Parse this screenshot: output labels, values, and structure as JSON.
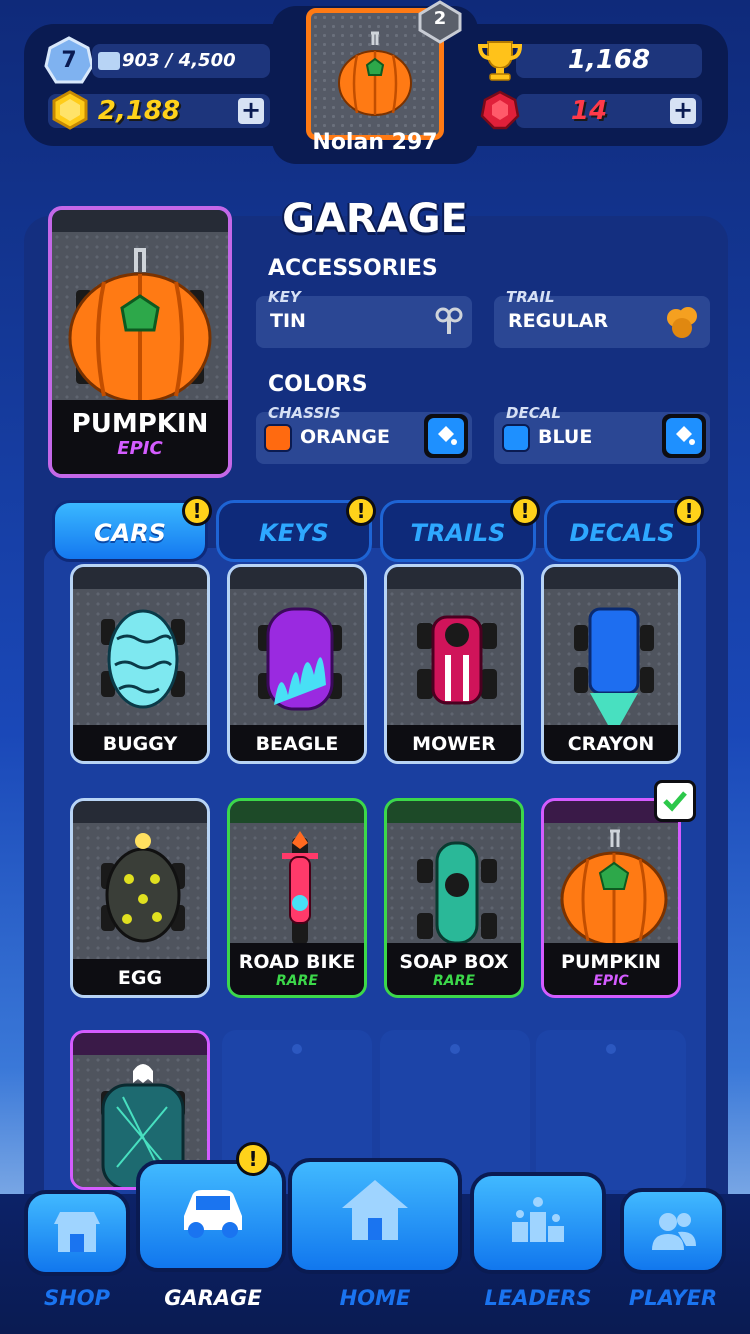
{
  "header": {
    "level": "7",
    "xp": "903 / 4,500",
    "coins": "2,188",
    "trophies": "1,168",
    "gems": "14",
    "player_rank": "2",
    "player_name": "Nolan 297",
    "plus_icon": "+"
  },
  "garage": {
    "title": "GARAGE",
    "selected_car": {
      "name": "PUMPKIN",
      "rarity": "EPIC"
    },
    "accessories_heading": "ACCESSORIES",
    "key": {
      "caption": "KEY",
      "value": "TIN"
    },
    "trail": {
      "caption": "TRAIL",
      "value": "REGULAR"
    },
    "colors_heading": "COLORS",
    "chassis": {
      "caption": "CHASSIS",
      "value": "ORANGE",
      "color": "#ff6a10"
    },
    "decal": {
      "caption": "DECAL",
      "value": "BLUE",
      "color": "#1e90ff"
    }
  },
  "tabs": [
    {
      "label": "CARS",
      "alert": "!"
    },
    {
      "label": "KEYS",
      "alert": "!"
    },
    {
      "label": "TRAILS",
      "alert": "!"
    },
    {
      "label": "DECALS",
      "alert": "!"
    }
  ],
  "cars": [
    {
      "name": "BUGGY",
      "rarity": ""
    },
    {
      "name": "BEAGLE",
      "rarity": ""
    },
    {
      "name": "MOWER",
      "rarity": ""
    },
    {
      "name": "CRAYON",
      "rarity": ""
    },
    {
      "name": "EGG",
      "rarity": ""
    },
    {
      "name": "ROAD BIKE",
      "rarity": "RARE"
    },
    {
      "name": "SOAP BOX",
      "rarity": "RARE"
    },
    {
      "name": "PUMPKIN",
      "rarity": "EPIC"
    }
  ],
  "nav": {
    "shop": "SHOP",
    "garage": "GARAGE",
    "home": "HOME",
    "leaders": "LEADERS",
    "player": "PLAYER",
    "garage_alert": "!"
  },
  "colors": {
    "rare": "#3cd84a",
    "epic": "#d45cff",
    "common": "#b8d4f5",
    "accent": "#1e90ff"
  }
}
